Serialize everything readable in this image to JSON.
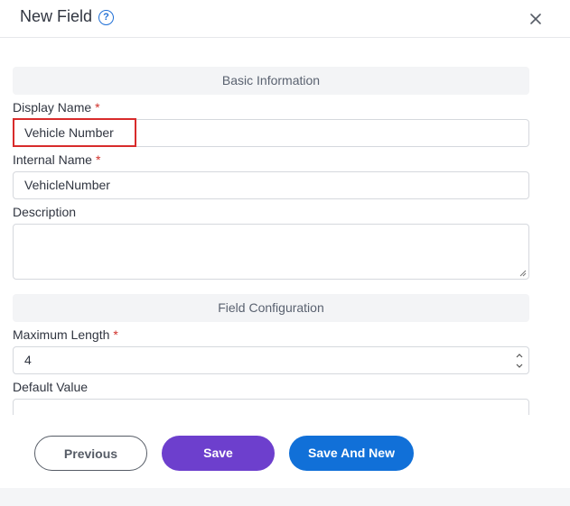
{
  "header": {
    "title": "New Field",
    "help_glyph": "?"
  },
  "sections": {
    "basic": "Basic Information",
    "config": "Field Configuration"
  },
  "fields": {
    "display_name": {
      "label": "Display Name",
      "required": "*",
      "value": "Vehicle Number"
    },
    "internal_name": {
      "label": "Internal Name",
      "required": "*",
      "value": "VehicleNumber"
    },
    "description": {
      "label": "Description",
      "value": ""
    },
    "max_length": {
      "label": "Maximum Length",
      "required": "*",
      "value": "4"
    },
    "default_value": {
      "label": "Default Value",
      "value": ""
    }
  },
  "footer": {
    "previous_label": "Previous",
    "save_label": "Save",
    "save_and_new_label": "Save And New"
  },
  "colors": {
    "save": "#6d3fcd",
    "save_and_new": "#1170d8",
    "required": "#d0302a",
    "highlight": "#d82b2b"
  },
  "icons": {
    "help": "help-circle-icon",
    "close": "close-icon",
    "spinner": "spinner-arrows-icon",
    "resize": "resize-grip-icon"
  }
}
